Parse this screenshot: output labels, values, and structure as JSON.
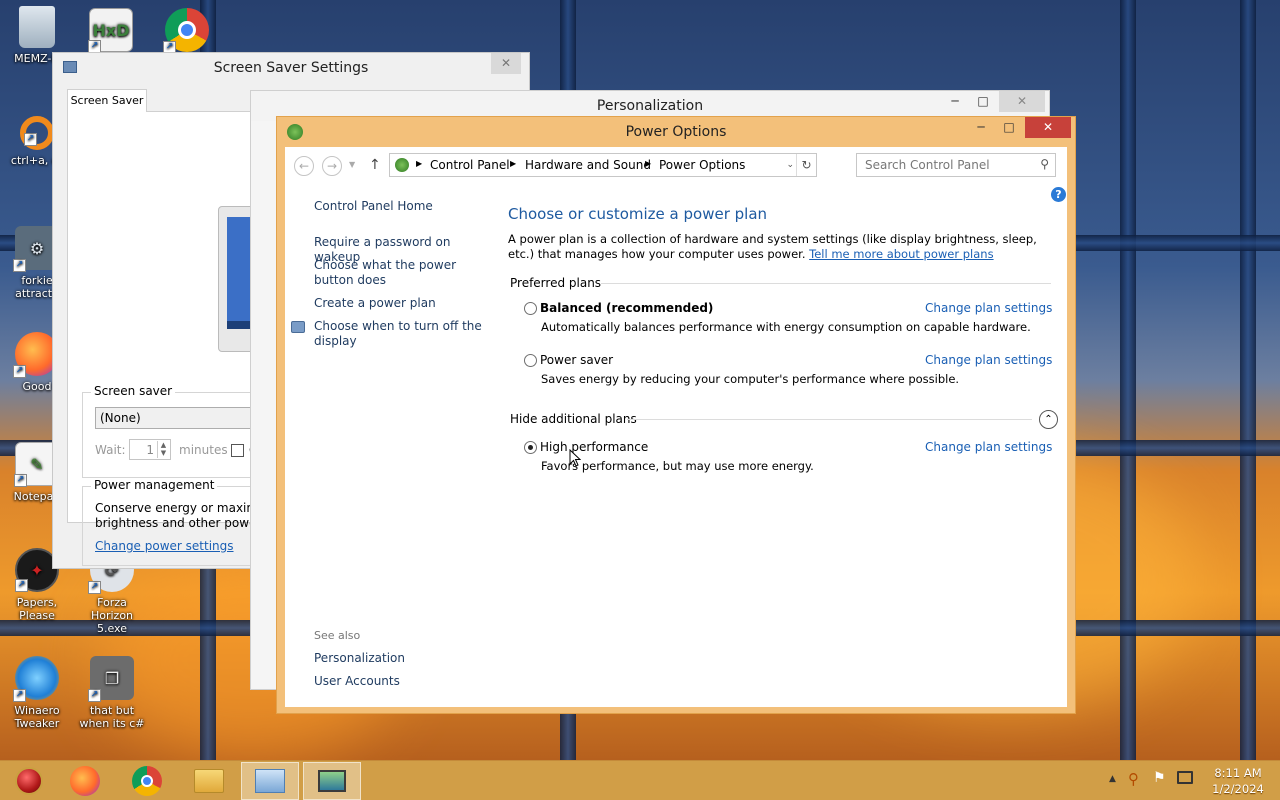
{
  "desktop": {
    "icons": [
      {
        "label": "MEMZ-D"
      },
      {
        "label": "ctrl+a, er"
      },
      {
        "label": "forkie attracta"
      },
      {
        "label": "Good"
      },
      {
        "label": "Notepad"
      },
      {
        "label": "Papers, Please"
      },
      {
        "label": "Forza Horizon 5.exe"
      },
      {
        "label": "Winaero Tweaker"
      },
      {
        "label": "that but when its c#"
      }
    ]
  },
  "screensaver_window": {
    "title": "Screen Saver Settings",
    "tab": "Screen Saver",
    "screen_saver_group": "Screen saver",
    "selected": "(None)",
    "wait_label": "Wait:",
    "wait_value": "1",
    "minutes_label": "minutes",
    "on_label": "On",
    "power_group": "Power management",
    "power_text_1": "Conserve energy or maximize perfo",
    "power_text_2": "brightness and other power setting",
    "change_power_link": "Change power settings"
  },
  "personalization_window": {
    "title": "Personalization"
  },
  "power_window": {
    "title": "Power Options",
    "breadcrumb": [
      "Control Panel",
      "Hardware and Sound",
      "Power Options"
    ],
    "search_placeholder": "Search Control Panel",
    "sidebar": {
      "home": "Control Panel Home",
      "links": [
        "Require a password on wakeup",
        "Choose what the power button does",
        "Create a power plan",
        "Choose when to turn off the display"
      ],
      "see_also_heading": "See also",
      "see_also": [
        "Personalization",
        "User Accounts"
      ]
    },
    "main": {
      "heading": "Choose or customize a power plan",
      "description": "A power plan is a collection of hardware and system settings (like display brightness, sleep, etc.) that manages how your computer uses power.",
      "learn_more": "Tell me more about power plans",
      "preferred_heading": "Preferred plans",
      "hide_heading": "Hide additional plans",
      "change_settings": "Change plan settings",
      "plans": [
        {
          "name": "Balanced (recommended)",
          "desc": "Automatically balances performance with energy consumption on capable hardware.",
          "selected": false
        },
        {
          "name": "Power saver",
          "desc": "Saves energy by reducing your computer's performance where possible.",
          "selected": false
        },
        {
          "name": "High performance",
          "desc": "Favors performance, but may use more energy.",
          "selected": true
        }
      ]
    }
  },
  "taskbar": {
    "time": "8:11 AM",
    "date": "1/2/2024"
  },
  "colors": {
    "taskbar": "#cd9637",
    "power_frame": "#f3c07a",
    "link": "#1a5fb4",
    "heading": "#1e5aa0",
    "close_button": "#c7413a"
  }
}
